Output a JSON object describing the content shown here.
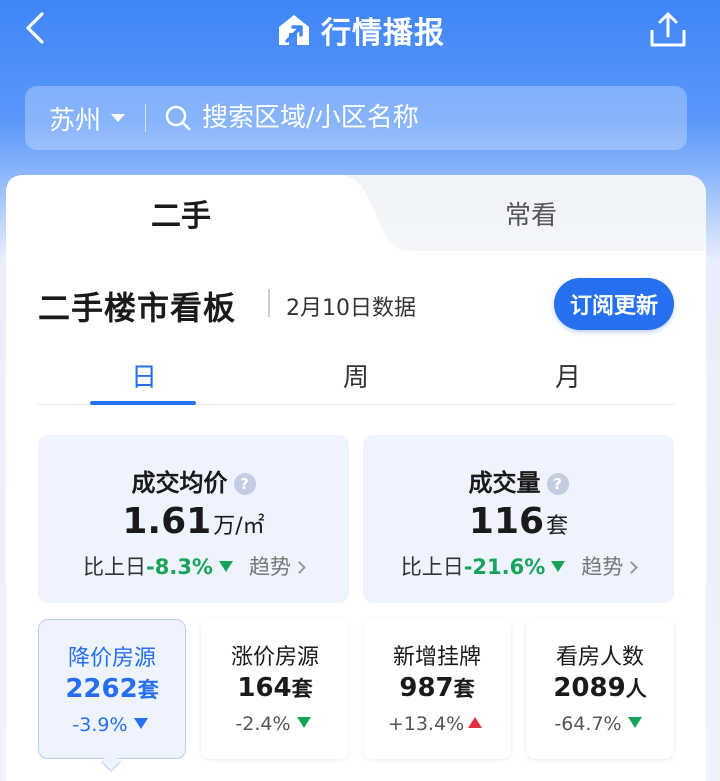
{
  "header": {
    "title": "行情播报",
    "back_icon": "chevron-left-icon",
    "share_icon": "share-upload-icon",
    "logo_icon": "house-arrow-logo"
  },
  "search": {
    "city": "苏州",
    "placeholder": "搜索区域/小区名称"
  },
  "tabs": [
    {
      "label": "二手",
      "active": true
    },
    {
      "label": "常看",
      "active": false
    }
  ],
  "board": {
    "title": "二手楼市看板",
    "date": "2月10日数据",
    "subscribe_label": "订阅更新"
  },
  "period_tabs": [
    {
      "label": "日",
      "active": true
    },
    {
      "label": "周",
      "active": false
    },
    {
      "label": "月",
      "active": false
    }
  ],
  "big_stats": [
    {
      "label": "成交均价",
      "value": "1.61",
      "unit": "万/㎡",
      "compare_label": "比上日",
      "change": "-8.3%",
      "direction": "down",
      "trend_label": "趋势"
    },
    {
      "label": "成交量",
      "value": "116",
      "unit": "套",
      "compare_label": "比上日",
      "change": "-21.6%",
      "direction": "down",
      "trend_label": "趋势"
    }
  ],
  "small_stats": [
    {
      "label": "降价房源",
      "value": "2262",
      "unit": "套",
      "change": "-3.9%",
      "direction": "down",
      "selected": true
    },
    {
      "label": "涨价房源",
      "value": "164",
      "unit": "套",
      "change": "-2.4%",
      "direction": "down",
      "selected": false
    },
    {
      "label": "新增挂牌",
      "value": "987",
      "unit": "套",
      "change": "+13.4%",
      "direction": "up",
      "selected": false
    },
    {
      "label": "看房人数",
      "value": "2089",
      "unit": "人",
      "change": "-64.7%",
      "direction": "down",
      "selected": false
    }
  ],
  "colors": {
    "accent": "#2670f0",
    "down": "#17a45a",
    "up": "#e0333d"
  }
}
